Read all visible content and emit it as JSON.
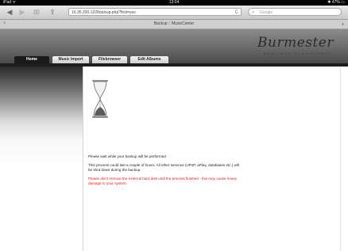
{
  "status_bar": {
    "left": "iPad ᯤ",
    "time": "13:04",
    "right": "✱ 47% ▭"
  },
  "browser": {
    "back_glyph": "◀",
    "forward_glyph": "▶",
    "bookmarks_glyph": "▯▯",
    "share_glyph": "⇪",
    "url": "10.35.200.122/backup.php?first=yes",
    "reload_glyph": "C",
    "search_placeholder": "Google",
    "search_glyph": "⌕"
  },
  "tab": {
    "title": "Backup :: MusicCenter",
    "close_glyph": "×",
    "add_glyph": "+"
  },
  "site": {
    "logo": "Burmester",
    "tagline": "BERLINER KLANGKUNST",
    "nav": [
      {
        "label": "Home",
        "active": true
      },
      {
        "label": "Music Import",
        "active": false
      },
      {
        "label": "Filebrowser",
        "active": false
      },
      {
        "label": "Edit Albums",
        "active": false
      }
    ]
  },
  "content": {
    "line1": "Please wait while your backup will be performed.",
    "line2a": "This process could last a couple of hours. All other services (UPnP, aPlay, databases etc.) will",
    "line2b": "be shut down during the backup.",
    "warning_a": "Please don't remove the external hard disk until the process finished - this may cause heavy",
    "warning_b": "damage to your system."
  },
  "colors": {
    "warning": "#d61f1f",
    "header_dark": "#1a1a1a"
  }
}
